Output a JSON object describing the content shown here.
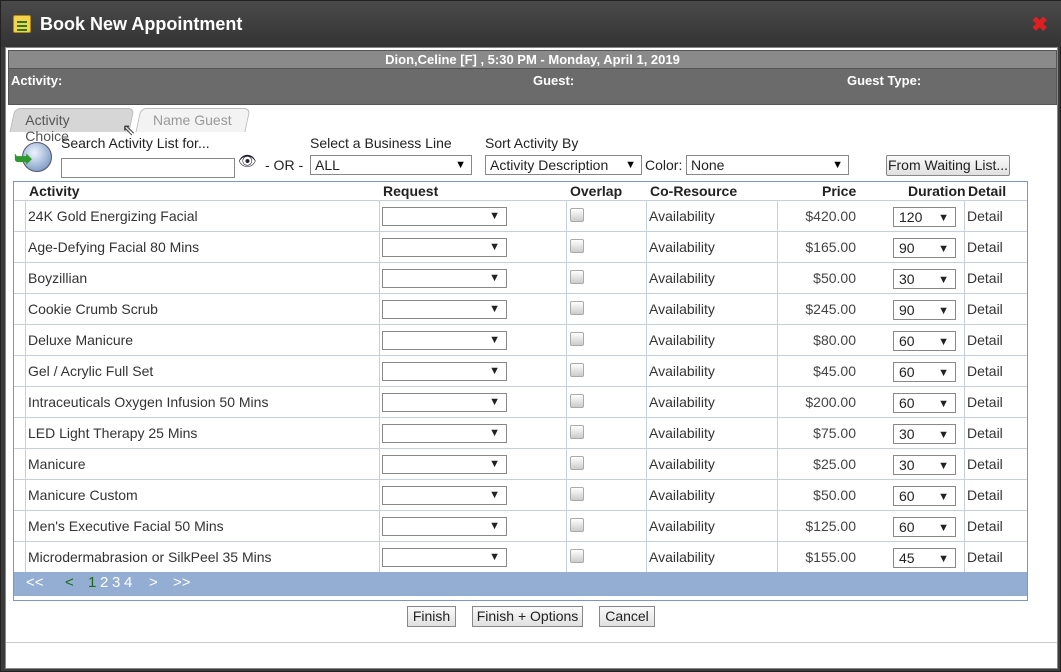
{
  "window": {
    "title": "Book New Appointment",
    "close_glyph": "✖"
  },
  "info": {
    "guest_line": "Dion,Celine [F] , 5:30 PM - Monday, April 1, 2019",
    "activity_label": "Activity:",
    "guest_label": "Guest:",
    "guest_type_label": "Guest Type:"
  },
  "tabs": [
    {
      "label": "Activity Choice",
      "active": true
    },
    {
      "label": "Name Guest",
      "active": false
    }
  ],
  "search": {
    "label": "Search Activity List for...",
    "value": "",
    "or_label": "- OR -"
  },
  "business_line": {
    "label": "Select a Business Line",
    "value": "ALL"
  },
  "sort": {
    "label": "Sort Activity By",
    "value": "Activity Description"
  },
  "color": {
    "label": "Color:",
    "value": "None"
  },
  "waiting_list_button": "From Waiting List...",
  "columns": [
    "Activity",
    "Request",
    "Overlap",
    "Co-Resource",
    "Price",
    "Duration",
    "Detail"
  ],
  "rows": [
    {
      "activity": "24K Gold Energizing Facial",
      "co_resource": "Availability",
      "price": "$420.00",
      "duration": "120",
      "detail": "Detail"
    },
    {
      "activity": "Age-Defying Facial 80 Mins",
      "co_resource": "Availability",
      "price": "$165.00",
      "duration": "90",
      "detail": "Detail"
    },
    {
      "activity": "Boyzillian",
      "co_resource": "Availability",
      "price": "$50.00",
      "duration": "30",
      "detail": "Detail"
    },
    {
      "activity": "Cookie Crumb Scrub",
      "co_resource": "Availability",
      "price": "$245.00",
      "duration": "90",
      "detail": "Detail"
    },
    {
      "activity": "Deluxe Manicure",
      "co_resource": "Availability",
      "price": "$80.00",
      "duration": "60",
      "detail": "Detail"
    },
    {
      "activity": "Gel / Acrylic Full Set",
      "co_resource": "Availability",
      "price": "$45.00",
      "duration": "60",
      "detail": "Detail"
    },
    {
      "activity": "Intraceuticals Oxygen Infusion 50 Mins",
      "co_resource": "Availability",
      "price": "$200.00",
      "duration": "60",
      "detail": "Detail"
    },
    {
      "activity": "LED Light Therapy 25 Mins",
      "co_resource": "Availability",
      "price": "$75.00",
      "duration": "30",
      "detail": "Detail"
    },
    {
      "activity": "Manicure",
      "co_resource": "Availability",
      "price": "$25.00",
      "duration": "30",
      "detail": "Detail"
    },
    {
      "activity": "Manicure Custom",
      "co_resource": "Availability",
      "price": "$50.00",
      "duration": "60",
      "detail": "Detail"
    },
    {
      "activity": "Men's Executive Facial 50 Mins",
      "co_resource": "Availability",
      "price": "$125.00",
      "duration": "60",
      "detail": "Detail"
    },
    {
      "activity": "Microdermabrasion or SilkPeel 35 Mins",
      "co_resource": "Availability",
      "price": "$155.00",
      "duration": "45",
      "detail": "Detail"
    }
  ],
  "pager": {
    "first": "<<",
    "prev": "<",
    "current": "1",
    "pages": [
      "2",
      "3",
      "4"
    ],
    "next": ">",
    "last": ">>"
  },
  "footer": {
    "finish": "Finish",
    "finish_options": "Finish + Options",
    "cancel": "Cancel"
  },
  "icons": {
    "app": "calendar-icon",
    "close": "close-icon",
    "globe": "globe-search-icon",
    "binoculars": "binoculars-icon",
    "dropdown": "chevron-down-icon",
    "cursor": "mouse-cursor-icon"
  },
  "colors": {
    "title_bar": "#3a3a3a",
    "info_bar": "#6b6b6b",
    "pager": "#93aed2",
    "close": "#e02020",
    "current_page": "#1a6a1a"
  }
}
